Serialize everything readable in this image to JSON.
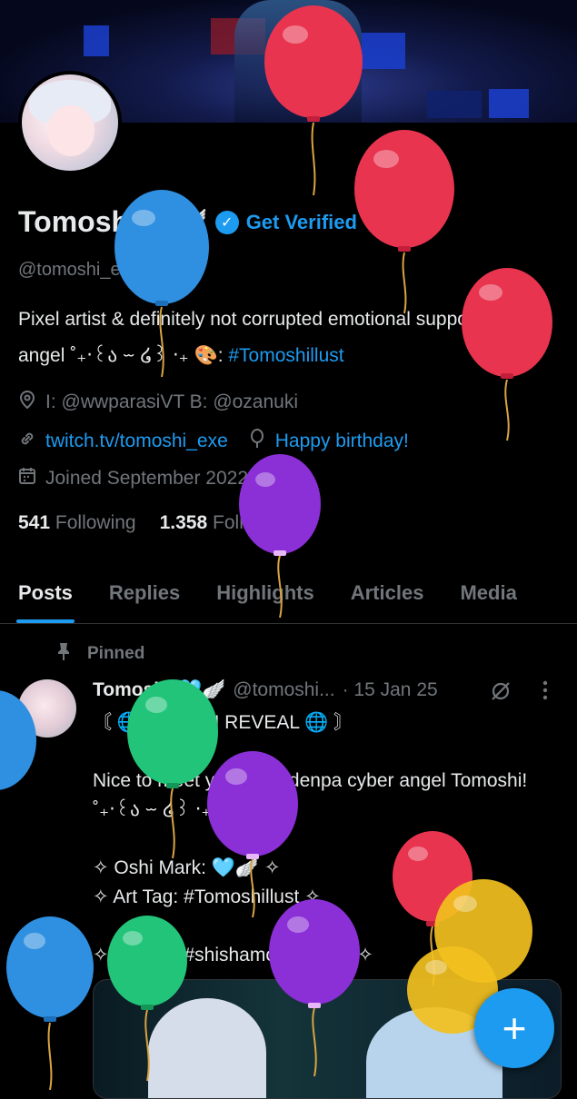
{
  "profile": {
    "name": "Tomoshi",
    "name_emoji": "🩵🪽",
    "verified_mark": "✓",
    "get_verified": "Get Verified",
    "handle": "@tomoshi_exe",
    "bio_text": "Pixel artist & definitely not corrupted emotional support angel ˚₊‧꒰ა ⏖ ໒꒱ ‧₊ 🎨: ",
    "bio_hashtag": "#Tomoshillust",
    "location": "I: @wwparasiVT B: @ozanuki",
    "website": "twitch.tv/tomoshi_exe",
    "birthday": "Happy birthday!",
    "joined": "Joined September 2022",
    "following_count": "541",
    "following_label": "Following",
    "followers_count": "1.358",
    "followers_label": "Followers"
  },
  "tabs": [
    "Posts",
    "Replies",
    "Highlights",
    "Articles",
    "Media"
  ],
  "pinned_post": {
    "pinned_label": "Pinned",
    "author_name": "Tomoshi",
    "author_emoji": "🩵🪽",
    "author_handle": "@tomoshi...",
    "date": "· 15 Jan 25",
    "text": "〘 🌐 DESIGN REVEAL 🌐 〙\n\nNice to meet you, I am denpa cyber angel Tomoshi!˚₊‧꒰ა ⏖ ໒꒱ ‧₊˚\n\n✧ Oshi Mark: 🩵🪽 ✧\n✧ Art Tag: #Tomoshillust ✧\n\n✧ Design: #shishamosama 🤍 ✧"
  },
  "icons": {
    "verified": "verified-check-icon",
    "location": "location-pin-icon",
    "link": "link-icon",
    "birthday": "balloon-icon",
    "calendar": "calendar-icon",
    "pin": "pin-icon",
    "grok": "grok-icon",
    "more": "more-vertical-icon",
    "compose": "compose-plus-icon"
  },
  "colors": {
    "accent": "#1d9bf0",
    "text": "#e7e9ea",
    "muted": "#71767b",
    "background": "#000000"
  },
  "balloon_colors": [
    "#e8344f",
    "#2f8fe0",
    "#8b2fd6",
    "#22c47a",
    "#f2c01e"
  ]
}
